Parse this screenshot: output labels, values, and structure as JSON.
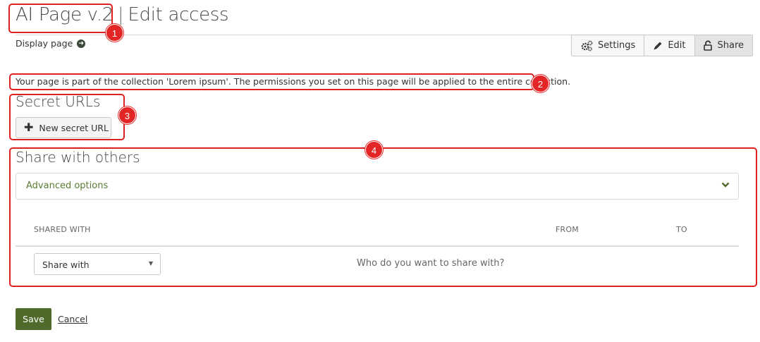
{
  "header": {
    "page_name": "AI Page v.2",
    "separator": "|",
    "subtitle": "Edit access",
    "display_link": "Display page"
  },
  "toolbar": {
    "settings": "Settings",
    "edit": "Edit",
    "share": "Share"
  },
  "notice": "Your page is part of the collection 'Lorem ipsum'. The permissions you set on this page will be applied to the entire collection.",
  "secret_urls": {
    "heading": "Secret URLs",
    "new_button": "New secret URL"
  },
  "share_others": {
    "heading": "Share with others",
    "advanced_options": "Advanced options",
    "columns": [
      "SHARED WITH",
      "FROM",
      "TO"
    ],
    "select_value": "Share with",
    "prompt": "Who do you want to share with?"
  },
  "footer": {
    "save": "Save",
    "cancel": "Cancel"
  },
  "annotations": [
    "1",
    "2",
    "3",
    "4"
  ],
  "colors": {
    "accent": "#4f6b2b",
    "annotation": "#e02020",
    "advanced_text": "#5a7a33"
  }
}
